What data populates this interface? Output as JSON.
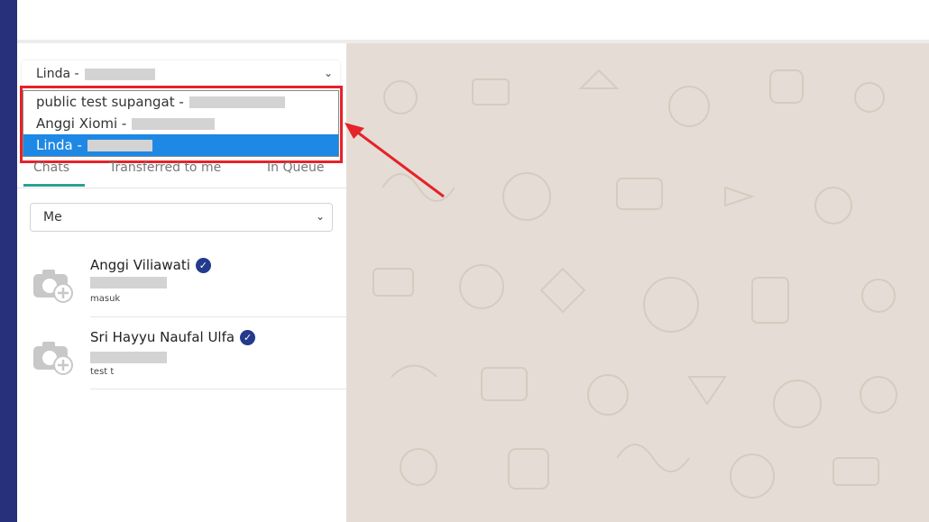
{
  "device_selector": {
    "value": "Linda -",
    "caret_icon": "chevron-down-icon"
  },
  "dropdown": {
    "options": [
      {
        "label": "public test supangat -",
        "selected": false
      },
      {
        "label": "Anggi Xiomi -",
        "selected": false
      },
      {
        "label": "Linda -",
        "selected": true
      }
    ]
  },
  "tabs": [
    {
      "label": "Chats",
      "active": true
    },
    {
      "label": "Transferred to me",
      "active": false
    },
    {
      "label": "In Queue",
      "active": false
    }
  ],
  "filter": {
    "value": "Me"
  },
  "chats": [
    {
      "name": "Anggi Viliawati",
      "message": "masuk",
      "verified": true
    },
    {
      "name": "Sri Hayyu Naufal Ulfa",
      "message": "test t",
      "verified": true
    }
  ],
  "colors": {
    "accent_blue": "#1e88e5",
    "highlight_red": "#e5232a",
    "sidebar_strip": "#27307b",
    "chat_bg": "#e5ddd5"
  }
}
